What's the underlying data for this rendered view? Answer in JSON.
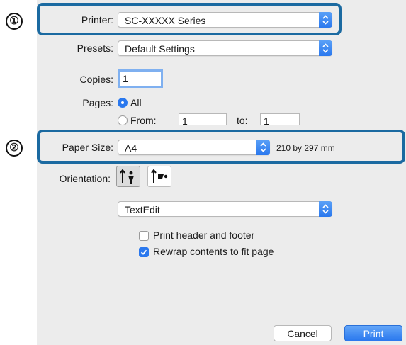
{
  "callouts": [
    "①",
    "②"
  ],
  "printer": {
    "label": "Printer:",
    "value": "SC-XXXXX Series"
  },
  "presets": {
    "label": "Presets:",
    "value": "Default Settings"
  },
  "copies": {
    "label": "Copies:",
    "value": "1"
  },
  "pages": {
    "label": "Pages:",
    "all_label": "All",
    "all_selected": true,
    "from_label": "From:",
    "from_value": "1",
    "to_label": "to:",
    "to_value": "1"
  },
  "paper_size": {
    "label": "Paper Size:",
    "value": "A4",
    "dimensions": "210 by 297 mm"
  },
  "orientation": {
    "label": "Orientation:",
    "selected": "portrait"
  },
  "app_menu": {
    "value": "TextEdit"
  },
  "options": [
    {
      "label": "Print header and footer",
      "checked": false
    },
    {
      "label": "Rewrap contents to fit page",
      "checked": true
    }
  ],
  "buttons": {
    "cancel": "Cancel",
    "print": "Print"
  },
  "colors": {
    "accent": "#2a78ee",
    "callout": "#1b6aa1"
  }
}
